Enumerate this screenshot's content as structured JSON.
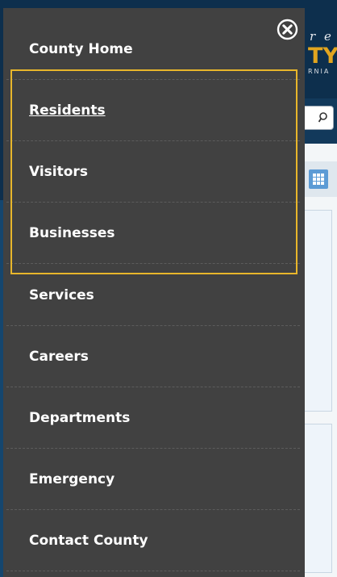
{
  "background": {
    "logo": {
      "script_text": "r e",
      "main_text": "TY",
      "sub_text": "RNIA"
    },
    "search_icon": "search-icon",
    "grid_icon": "grid-icon"
  },
  "menu": {
    "close_icon": "close-circle-icon",
    "items": [
      {
        "label": "County Home"
      },
      {
        "label": "Residents"
      },
      {
        "label": "Visitors"
      },
      {
        "label": "Businesses"
      },
      {
        "label": "Services"
      },
      {
        "label": "Careers"
      },
      {
        "label": "Departments"
      },
      {
        "label": "Emergency"
      },
      {
        "label": "Contact County"
      }
    ]
  },
  "colors": {
    "menu_background": "#414141",
    "menu_text": "#ffffff",
    "focus_outline": "#e8b62b",
    "header_navy": "#12395b",
    "logo_gold": "#e1a51f"
  }
}
